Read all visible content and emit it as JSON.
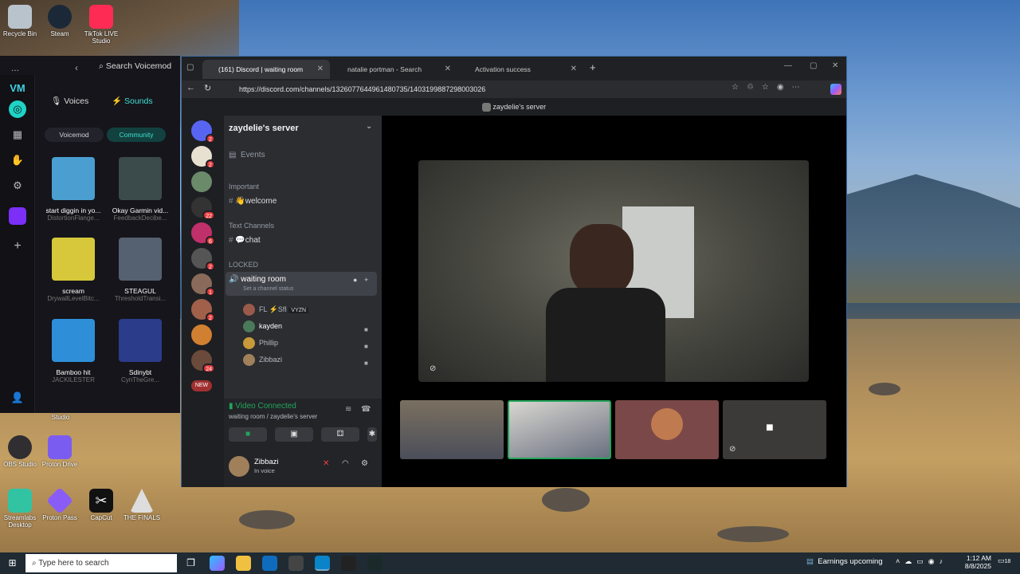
{
  "desktop": {
    "icons": [
      {
        "label": "Recycle Bin",
        "icon": "recycle-bin-icon",
        "color": "#b9c3cc"
      },
      {
        "label": "Steam",
        "icon": "steam-icon",
        "color": "#1b2838"
      },
      {
        "label": "TikTok LIVE Studio",
        "icon": "tiktok-icon",
        "color": "#fe2c55"
      },
      {
        "label": "Studio",
        "icon": "studio-icon",
        "color": "#444444"
      },
      {
        "label": "OBS Studio",
        "icon": "obs-icon",
        "color": "#302e31"
      },
      {
        "label": "Proton Drive",
        "icon": "proton-drive-icon",
        "color": "#7b5cf0"
      },
      {
        "label": "Streamlabs Desktop",
        "icon": "streamlabs-icon",
        "color": "#31c3a2"
      },
      {
        "label": "Proton Pass",
        "icon": "proton-pass-icon",
        "color": "#8a5cf6"
      },
      {
        "label": "CapCut",
        "icon": "capcut-icon",
        "color": "#111111"
      },
      {
        "label": "THE FINALS",
        "icon": "the-finals-icon",
        "color": "#dddddd"
      }
    ]
  },
  "voicemod": {
    "menu": "...",
    "search": "Search Voicemod",
    "tabs": {
      "voices": "Voices",
      "sounds": "Sounds"
    },
    "filters": {
      "voicemod": "Voicemod",
      "community": "Community"
    },
    "sounds": [
      {
        "title": "start diggin in yo...",
        "author": "DistortionFlange...",
        "color": "#4a9fd0"
      },
      {
        "title": "Okay Garmin vid...",
        "author": "FeedbackDecibe...",
        "color": "#3b4a4a"
      },
      {
        "title": "scream",
        "author": "DrywallLevelBitc...",
        "color": "#d6c83a"
      },
      {
        "title": "STEAGUL",
        "author": "ThresholdTransi...",
        "color": "#556070"
      },
      {
        "title": "Bamboo hit",
        "author": "JACKILESTER",
        "color": "#2e8fd8"
      },
      {
        "title": "Sdinybt",
        "author": "CynTheGre...",
        "color": "#2a3c8a"
      }
    ]
  },
  "browser": {
    "tabs": [
      {
        "label": "(161) Discord | waiting room",
        "active": true
      },
      {
        "label": "natalie portman - Search",
        "active": false
      },
      {
        "label": "Activation success",
        "active": false
      }
    ],
    "new_tab": "+",
    "url": "https://discord.com/channels/1326077644961480735/1403199887298003026"
  },
  "discord": {
    "server_header": "zaydelie's server",
    "server_name": "zaydelie's server",
    "events": "Events",
    "sections": {
      "important": "Important",
      "text": "Text Channels",
      "locked": "LOCKED"
    },
    "channels": {
      "welcome": "👋welcome",
      "chat": "💬chat",
      "voice": "waiting room",
      "voice_status": "Set a channel status"
    },
    "members": [
      {
        "name": "FL ⚡SfI",
        "tag": "VYZN",
        "color": "#9a5a4a"
      },
      {
        "name": "kayden",
        "tag": "",
        "color": "#4a7a5a"
      },
      {
        "name": "Phillip",
        "tag": "",
        "color": "#c89a3a"
      },
      {
        "name": "Zibbazi",
        "tag": "",
        "color": "#a0805a"
      }
    ],
    "guild_badges": [
      "2",
      "2",
      "",
      "22",
      "6",
      "2",
      "1",
      "2",
      "",
      "24",
      "NEW"
    ],
    "voice_panel": {
      "title": "Video Connected",
      "subtitle": "waiting room / zaydelie's server"
    },
    "user": {
      "name": "Zibbazi",
      "status": "In voice"
    },
    "colors": {
      "blurple": "#5865f2",
      "green": "#23a55a",
      "red": "#f23f43"
    }
  },
  "taskbar": {
    "search": "Type here to search",
    "weather": "Earnings upcoming",
    "time": "1:12 AM",
    "date": "8/8/2025",
    "notif": "18"
  }
}
